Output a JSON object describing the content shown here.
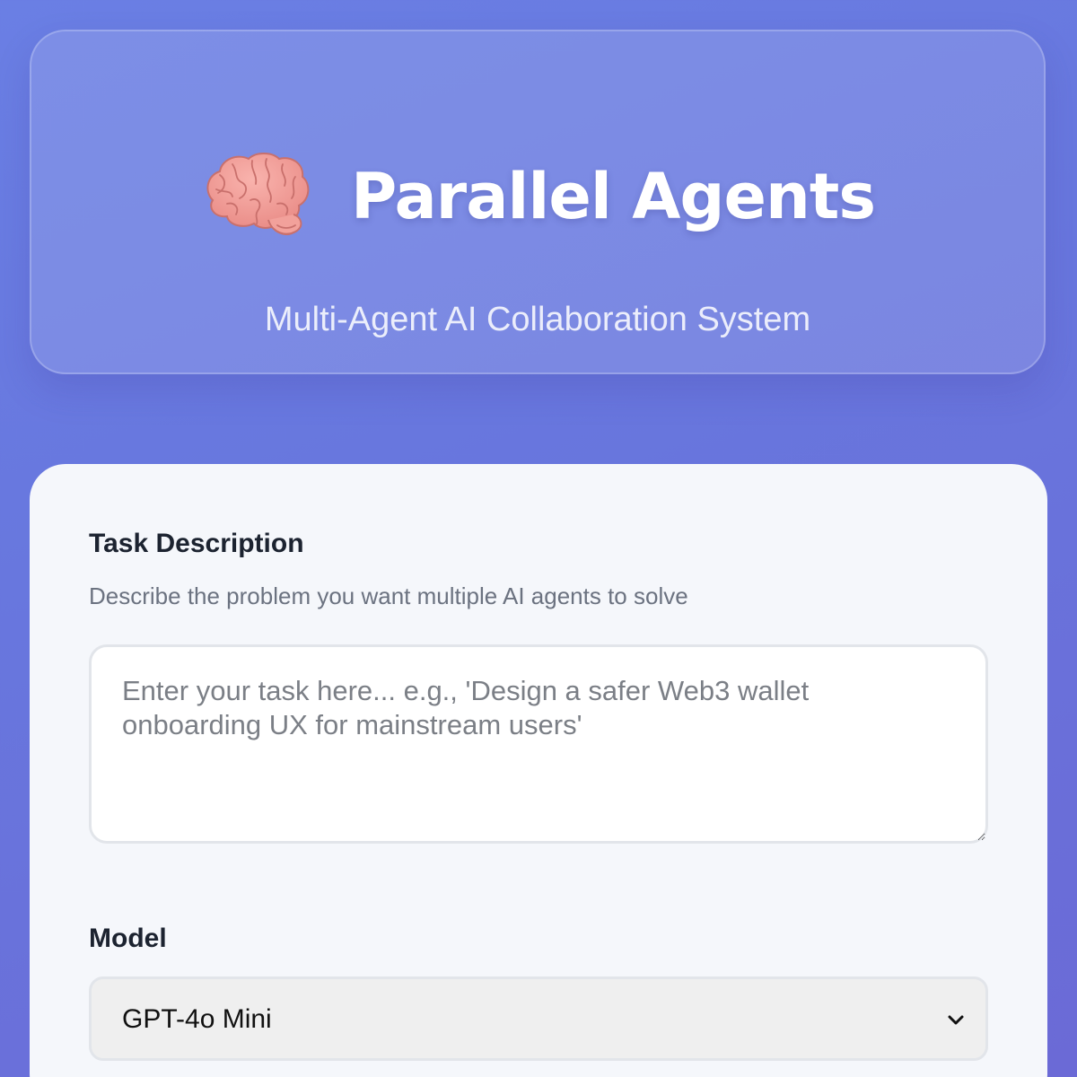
{
  "hero": {
    "icon": "brain-icon",
    "title": "Parallel Agents",
    "subtitle": "Multi-Agent AI Collaboration System"
  },
  "form": {
    "task": {
      "label": "Task Description",
      "helper": "Describe the problem you want multiple AI agents to solve",
      "placeholder": "Enter your task here... e.g., 'Design a safer Web3 wallet onboarding UX for mainstream users'",
      "value": ""
    },
    "model": {
      "label": "Model",
      "selected": "GPT-4o Mini",
      "icon": "chevron-down-icon"
    }
  },
  "colors": {
    "background_gradient_start": "#6a7fe4",
    "background_gradient_end": "#6b6ad6",
    "card_background": "#f5f7fb",
    "label_text": "#1c2330",
    "helper_text": "#6b7280"
  }
}
